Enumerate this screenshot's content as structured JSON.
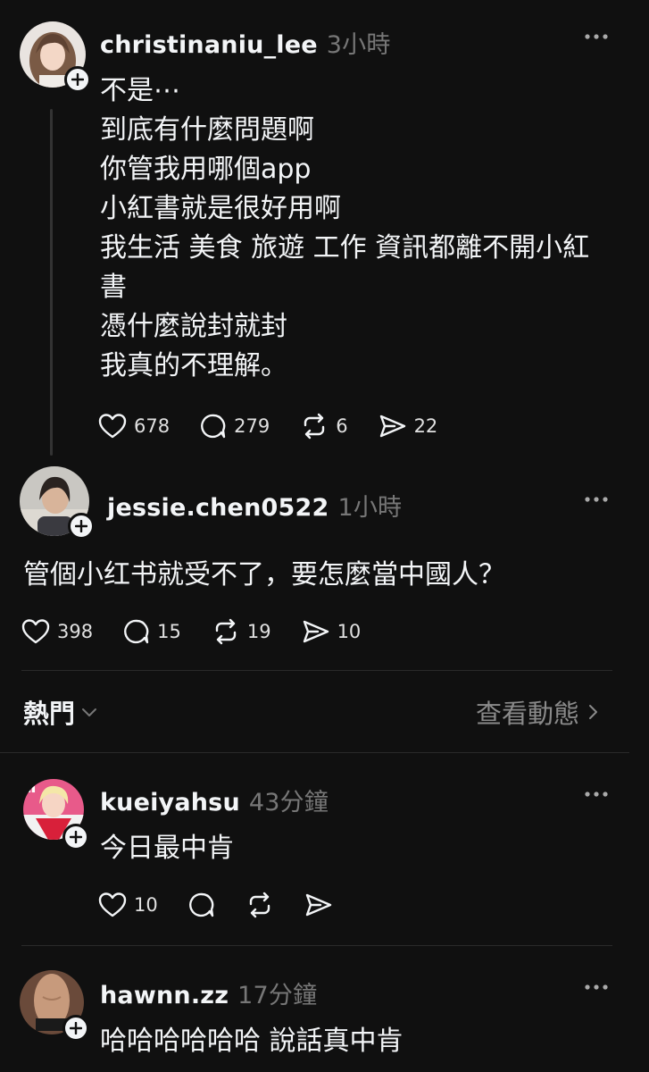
{
  "posts": [
    {
      "username": "christinaniu_lee",
      "time": "3小時",
      "lines": [
        "不是⋯",
        "到底有什麼問題啊",
        "你管我用哪個app",
        "小紅書就是很好用啊",
        "我生活 美食 旅遊 工作 資訊都離不開小紅",
        "書",
        "憑什麼說封就封",
        "我真的不理解。"
      ],
      "likes": "678",
      "replies": "279",
      "reposts": "6",
      "shares": "22"
    },
    {
      "username": "jessie.chen0522",
      "time": "1小時",
      "text": "管個小红书就受不了，要怎麼當中國人？",
      "likes": "398",
      "replies": "15",
      "reposts": "19",
      "shares": "10"
    }
  ],
  "section": {
    "label": "熱門",
    "activity_link": "查看動態"
  },
  "replies": [
    {
      "username": "kueiyahsu",
      "time": "43分鐘",
      "text": "今日最中肯",
      "likes": "10"
    },
    {
      "username": "hawnn.zz",
      "time": "17分鐘",
      "text": "哈哈哈哈哈哈 說話真中肯"
    }
  ],
  "icons": [
    "heart-icon",
    "comment-icon",
    "repost-icon",
    "share-icon",
    "more-icon",
    "follow-plus-icon",
    "chevron-down-icon",
    "chevron-right-icon"
  ],
  "colors": {
    "background": "#101010",
    "text": "#f3f5f7",
    "muted": "#777777"
  }
}
